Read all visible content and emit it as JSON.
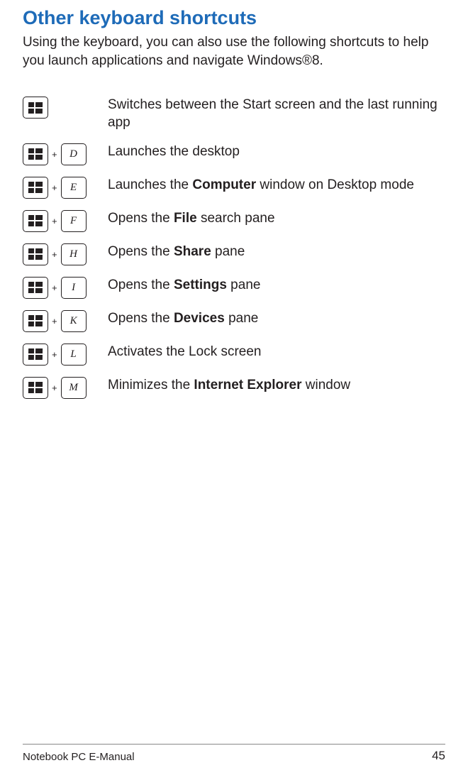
{
  "heading": "Other keyboard shortcuts",
  "intro": "Using the keyboard, you can also use the following shortcuts to help you launch applications and navigate Windows®8.",
  "shortcuts": [
    {
      "keys": [
        "win"
      ],
      "desc_parts": [
        {
          "text": "Switches between the Start screen and the last running app",
          "bold": false
        }
      ]
    },
    {
      "keys": [
        "win",
        "D"
      ],
      "desc_parts": [
        {
          "text": "Launches the desktop",
          "bold": false
        }
      ]
    },
    {
      "keys": [
        "win",
        "E"
      ],
      "desc_parts": [
        {
          "text": "Launches the ",
          "bold": false
        },
        {
          "text": "Computer",
          "bold": true
        },
        {
          "text": " window on Desktop mode",
          "bold": false
        }
      ]
    },
    {
      "keys": [
        "win",
        "F"
      ],
      "desc_parts": [
        {
          "text": "Opens the ",
          "bold": false
        },
        {
          "text": "File",
          "bold": true
        },
        {
          "text": " search pane",
          "bold": false
        }
      ]
    },
    {
      "keys": [
        "win",
        "H"
      ],
      "desc_parts": [
        {
          "text": "Opens the ",
          "bold": false
        },
        {
          "text": "Share",
          "bold": true
        },
        {
          "text": " pane",
          "bold": false
        }
      ]
    },
    {
      "keys": [
        "win",
        "I"
      ],
      "desc_parts": [
        {
          "text": "Opens the ",
          "bold": false
        },
        {
          "text": "Settings",
          "bold": true
        },
        {
          "text": " pane",
          "bold": false
        }
      ]
    },
    {
      "keys": [
        "win",
        "K"
      ],
      "desc_parts": [
        {
          "text": "Opens the ",
          "bold": false
        },
        {
          "text": "Devices",
          "bold": true
        },
        {
          "text": " pane",
          "bold": false
        }
      ]
    },
    {
      "keys": [
        "win",
        "L"
      ],
      "desc_parts": [
        {
          "text": "Activates the Lock screen",
          "bold": false
        }
      ]
    },
    {
      "keys": [
        "win",
        "M"
      ],
      "desc_parts": [
        {
          "text": "Minimizes the ",
          "bold": false
        },
        {
          "text": "Internet Explorer",
          "bold": true
        },
        {
          "text": " window",
          "bold": false
        }
      ]
    }
  ],
  "footer": {
    "left": "Notebook PC E-Manual",
    "right": "45"
  }
}
